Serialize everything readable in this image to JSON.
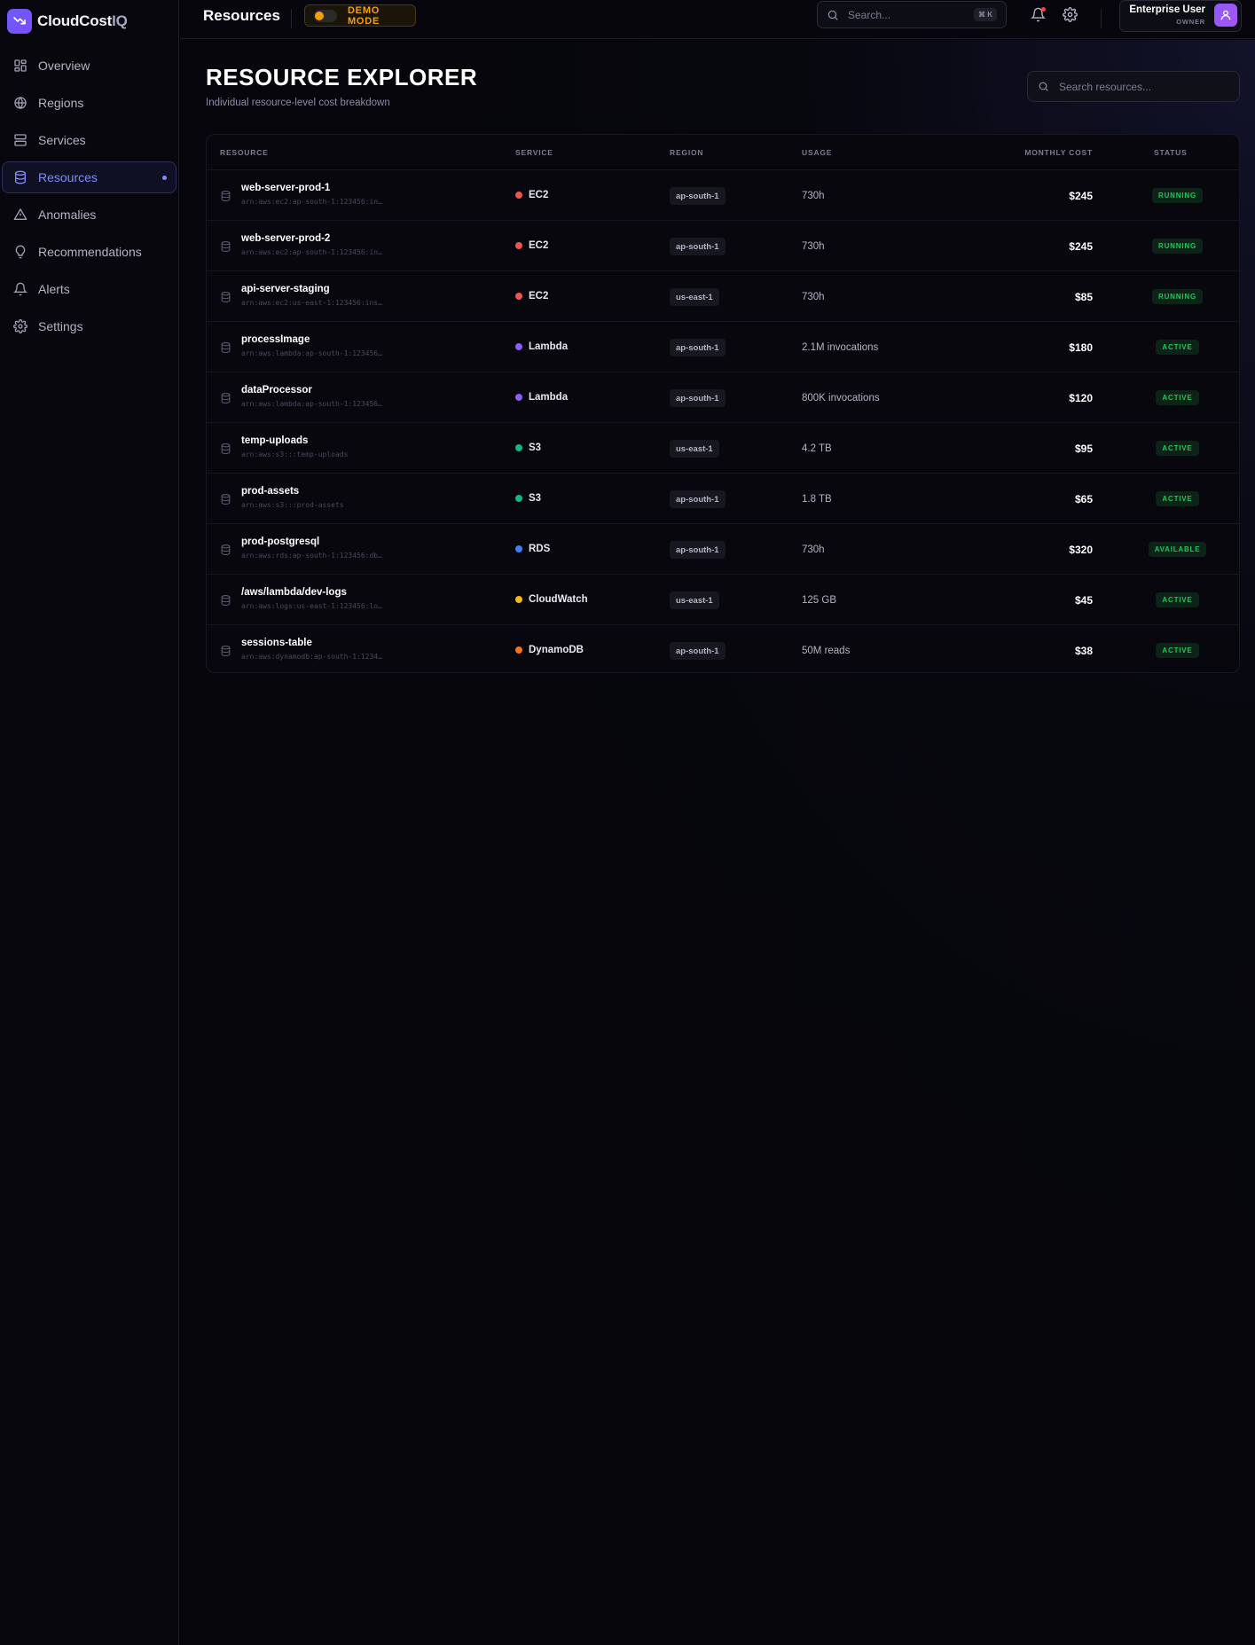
{
  "app": {
    "name_main": "CloudCost",
    "name_suffix": "IQ"
  },
  "sidebar": {
    "items": [
      {
        "label": "Overview",
        "icon": "grid-icon"
      },
      {
        "label": "Regions",
        "icon": "globe-icon"
      },
      {
        "label": "Services",
        "icon": "server-icon"
      },
      {
        "label": "Resources",
        "icon": "database-icon",
        "active": true
      },
      {
        "label": "Anomalies",
        "icon": "warning-icon"
      },
      {
        "label": "Recommendations",
        "icon": "lightbulb-icon"
      },
      {
        "label": "Alerts",
        "icon": "bell-icon"
      },
      {
        "label": "Settings",
        "icon": "gear-icon"
      }
    ]
  },
  "topbar": {
    "title": "Resources",
    "demo_label": "DEMO MODE",
    "search_placeholder": "Search...",
    "search_shortcut": "⌘ K",
    "user_name": "Enterprise User",
    "user_role": "OWNER"
  },
  "page": {
    "heading": "RESOURCE EXPLORER",
    "subheading": "Individual resource-level cost breakdown",
    "search_placeholder": "Search resources..."
  },
  "table": {
    "headers": {
      "resource": "RESOURCE",
      "service": "SERVICE",
      "region": "REGION",
      "usage": "USAGE",
      "cost": "MONTHLY COST",
      "status": "STATUS"
    },
    "rows": [
      {
        "name": "web-server-prod-1",
        "arn": "arn:aws:ec2:ap-south-1:123456:in…",
        "service": "EC2",
        "service_color": "#ef5350",
        "region": "ap-south-1",
        "usage": "730h",
        "cost": "$245",
        "status": "RUNNING"
      },
      {
        "name": "web-server-prod-2",
        "arn": "arn:aws:ec2:ap-south-1:123456:in…",
        "service": "EC2",
        "service_color": "#ef5350",
        "region": "ap-south-1",
        "usage": "730h",
        "cost": "$245",
        "status": "RUNNING"
      },
      {
        "name": "api-server-staging",
        "arn": "arn:aws:ec2:us-east-1:123456:ins…",
        "service": "EC2",
        "service_color": "#ef5350",
        "region": "us-east-1",
        "usage": "730h",
        "cost": "$85",
        "status": "RUNNING"
      },
      {
        "name": "processImage",
        "arn": "arn:aws:lambda:ap-south-1:123456…",
        "service": "Lambda",
        "service_color": "#8b5cf6",
        "region": "ap-south-1",
        "usage": "2.1M invocations",
        "cost": "$180",
        "status": "ACTIVE"
      },
      {
        "name": "dataProcessor",
        "arn": "arn:aws:lambda:ap-south-1:123456…",
        "service": "Lambda",
        "service_color": "#8b5cf6",
        "region": "ap-south-1",
        "usage": "800K invocations",
        "cost": "$120",
        "status": "ACTIVE"
      },
      {
        "name": "temp-uploads",
        "arn": "arn:aws:s3:::temp-uploads",
        "service": "S3",
        "service_color": "#10b981",
        "region": "us-east-1",
        "usage": "4.2 TB",
        "cost": "$95",
        "status": "ACTIVE"
      },
      {
        "name": "prod-assets",
        "arn": "arn:aws:s3:::prod-assets",
        "service": "S3",
        "service_color": "#10b981",
        "region": "ap-south-1",
        "usage": "1.8 TB",
        "cost": "$65",
        "status": "ACTIVE"
      },
      {
        "name": "prod-postgresql",
        "arn": "arn:aws:rds:ap-south-1:123456:db…",
        "service": "RDS",
        "service_color": "#3b82f6",
        "region": "ap-south-1",
        "usage": "730h",
        "cost": "$320",
        "status": "AVAILABLE"
      },
      {
        "name": "/aws/lambda/dev-logs",
        "arn": "arn:aws:logs:us-east-1:123456:lo…",
        "service": "CloudWatch",
        "service_color": "#f5b914",
        "region": "us-east-1",
        "usage": "125 GB",
        "cost": "$45",
        "status": "ACTIVE"
      },
      {
        "name": "sessions-table",
        "arn": "arn:aws:dynamodb:ap-south-1:1234…",
        "service": "DynamoDB",
        "service_color": "#f97316",
        "region": "ap-south-1",
        "usage": "50M reads",
        "cost": "$38",
        "status": "ACTIVE"
      }
    ]
  }
}
